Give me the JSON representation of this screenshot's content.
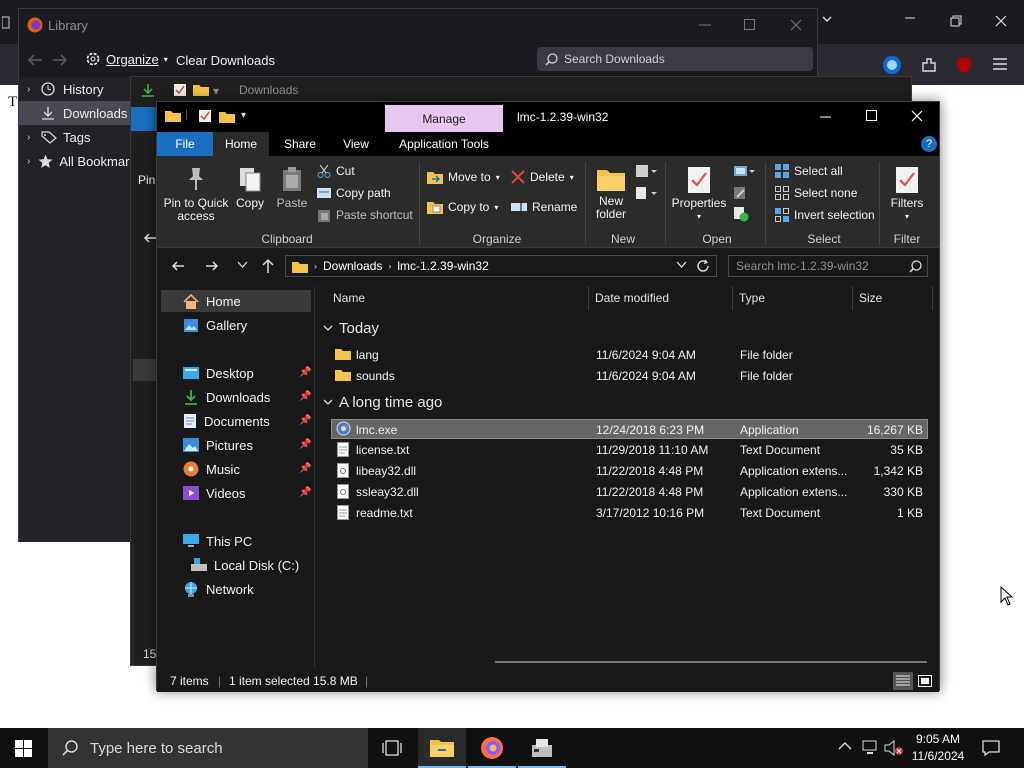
{
  "firefox": {
    "page_letter": "T"
  },
  "library": {
    "title": "Library",
    "organize_label": "Organize",
    "clear_downloads_label": "Clear Downloads",
    "search_placeholder": "Search Downloads",
    "sidebar": [
      {
        "label": "History",
        "icon": "clock-icon"
      },
      {
        "label": "Downloads",
        "icon": "download-icon",
        "selected": true
      },
      {
        "label": "Tags",
        "icon": "tag-icon"
      },
      {
        "label": "All Bookmarks",
        "icon": "star-icon"
      }
    ]
  },
  "middle_window": {
    "title": "Downloads",
    "ribbon_partial": "Pin",
    "status_partial": "15"
  },
  "explorer": {
    "title": "lmc-1.2.39-win32",
    "manage_tab": "Manage",
    "tabs": {
      "file": "File",
      "home": "Home",
      "share": "Share",
      "view": "View",
      "app_tools": "Application Tools"
    },
    "ribbon": {
      "pin_label": "Pin to Quick access",
      "copy_label": "Copy",
      "paste_label": "Paste",
      "cut_label": "Cut",
      "copy_path_label": "Copy path",
      "paste_shortcut_label": "Paste shortcut",
      "move_to_label": "Move to",
      "copy_to_label": "Copy to",
      "delete_label": "Delete",
      "rename_label": "Rename",
      "new_folder_label": "New folder",
      "properties_label": "Properties",
      "select_all_label": "Select all",
      "select_none_label": "Select none",
      "invert_selection_label": "Invert selection",
      "filters_label": "Filters",
      "groups": {
        "clipboard": "Clipboard",
        "organize": "Organize",
        "new": "New",
        "open": "Open",
        "select": "Select",
        "filter": "Filter"
      }
    },
    "address": {
      "segment1": "Downloads",
      "segment2": "lmc-1.2.39-win32",
      "search_placeholder": "Search lmc-1.2.39-win32"
    },
    "nav": {
      "home": "Home",
      "gallery": "Gallery",
      "desktop": "Desktop",
      "downloads": "Downloads",
      "documents": "Documents",
      "pictures": "Pictures",
      "music": "Music",
      "videos": "Videos",
      "this_pc": "This PC",
      "local_disk": "Local Disk (C:)",
      "network": "Network"
    },
    "columns": {
      "name": "Name",
      "date": "Date modified",
      "type": "Type",
      "size": "Size"
    },
    "groups": {
      "today": "Today",
      "long_ago": "A long time ago"
    },
    "today_files": [
      {
        "name": "lang",
        "date": "11/6/2024 9:04 AM",
        "type": "File folder",
        "size": ""
      },
      {
        "name": "sounds",
        "date": "11/6/2024 9:04 AM",
        "type": "File folder",
        "size": ""
      }
    ],
    "old_files": [
      {
        "name": "lmc.exe",
        "date": "12/24/2018 6:23 PM",
        "type": "Application",
        "size": "16,267 KB",
        "selected": true
      },
      {
        "name": "license.txt",
        "date": "11/29/2018 11:10 AM",
        "type": "Text Document",
        "size": "35 KB"
      },
      {
        "name": "libeay32.dll",
        "date": "11/22/2018 4:48 PM",
        "type": "Application extens...",
        "size": "1,342 KB"
      },
      {
        "name": "ssleay32.dll",
        "date": "11/22/2018 4:48 PM",
        "type": "Application extens...",
        "size": "330 KB"
      },
      {
        "name": "readme.txt",
        "date": "3/17/2012 10:16 PM",
        "type": "Text Document",
        "size": "1 KB"
      }
    ],
    "status": {
      "items": "7 items",
      "selected": "1 item selected  15.8 MB"
    }
  },
  "taskbar": {
    "search_placeholder": "Type here to search",
    "time": "9:05 AM",
    "date": "11/6/2024"
  },
  "colors": {
    "accent": "#1a6fc0",
    "manage_tab": "#e6c7ef",
    "selection": "#666666",
    "folder": "#f4c14a"
  }
}
